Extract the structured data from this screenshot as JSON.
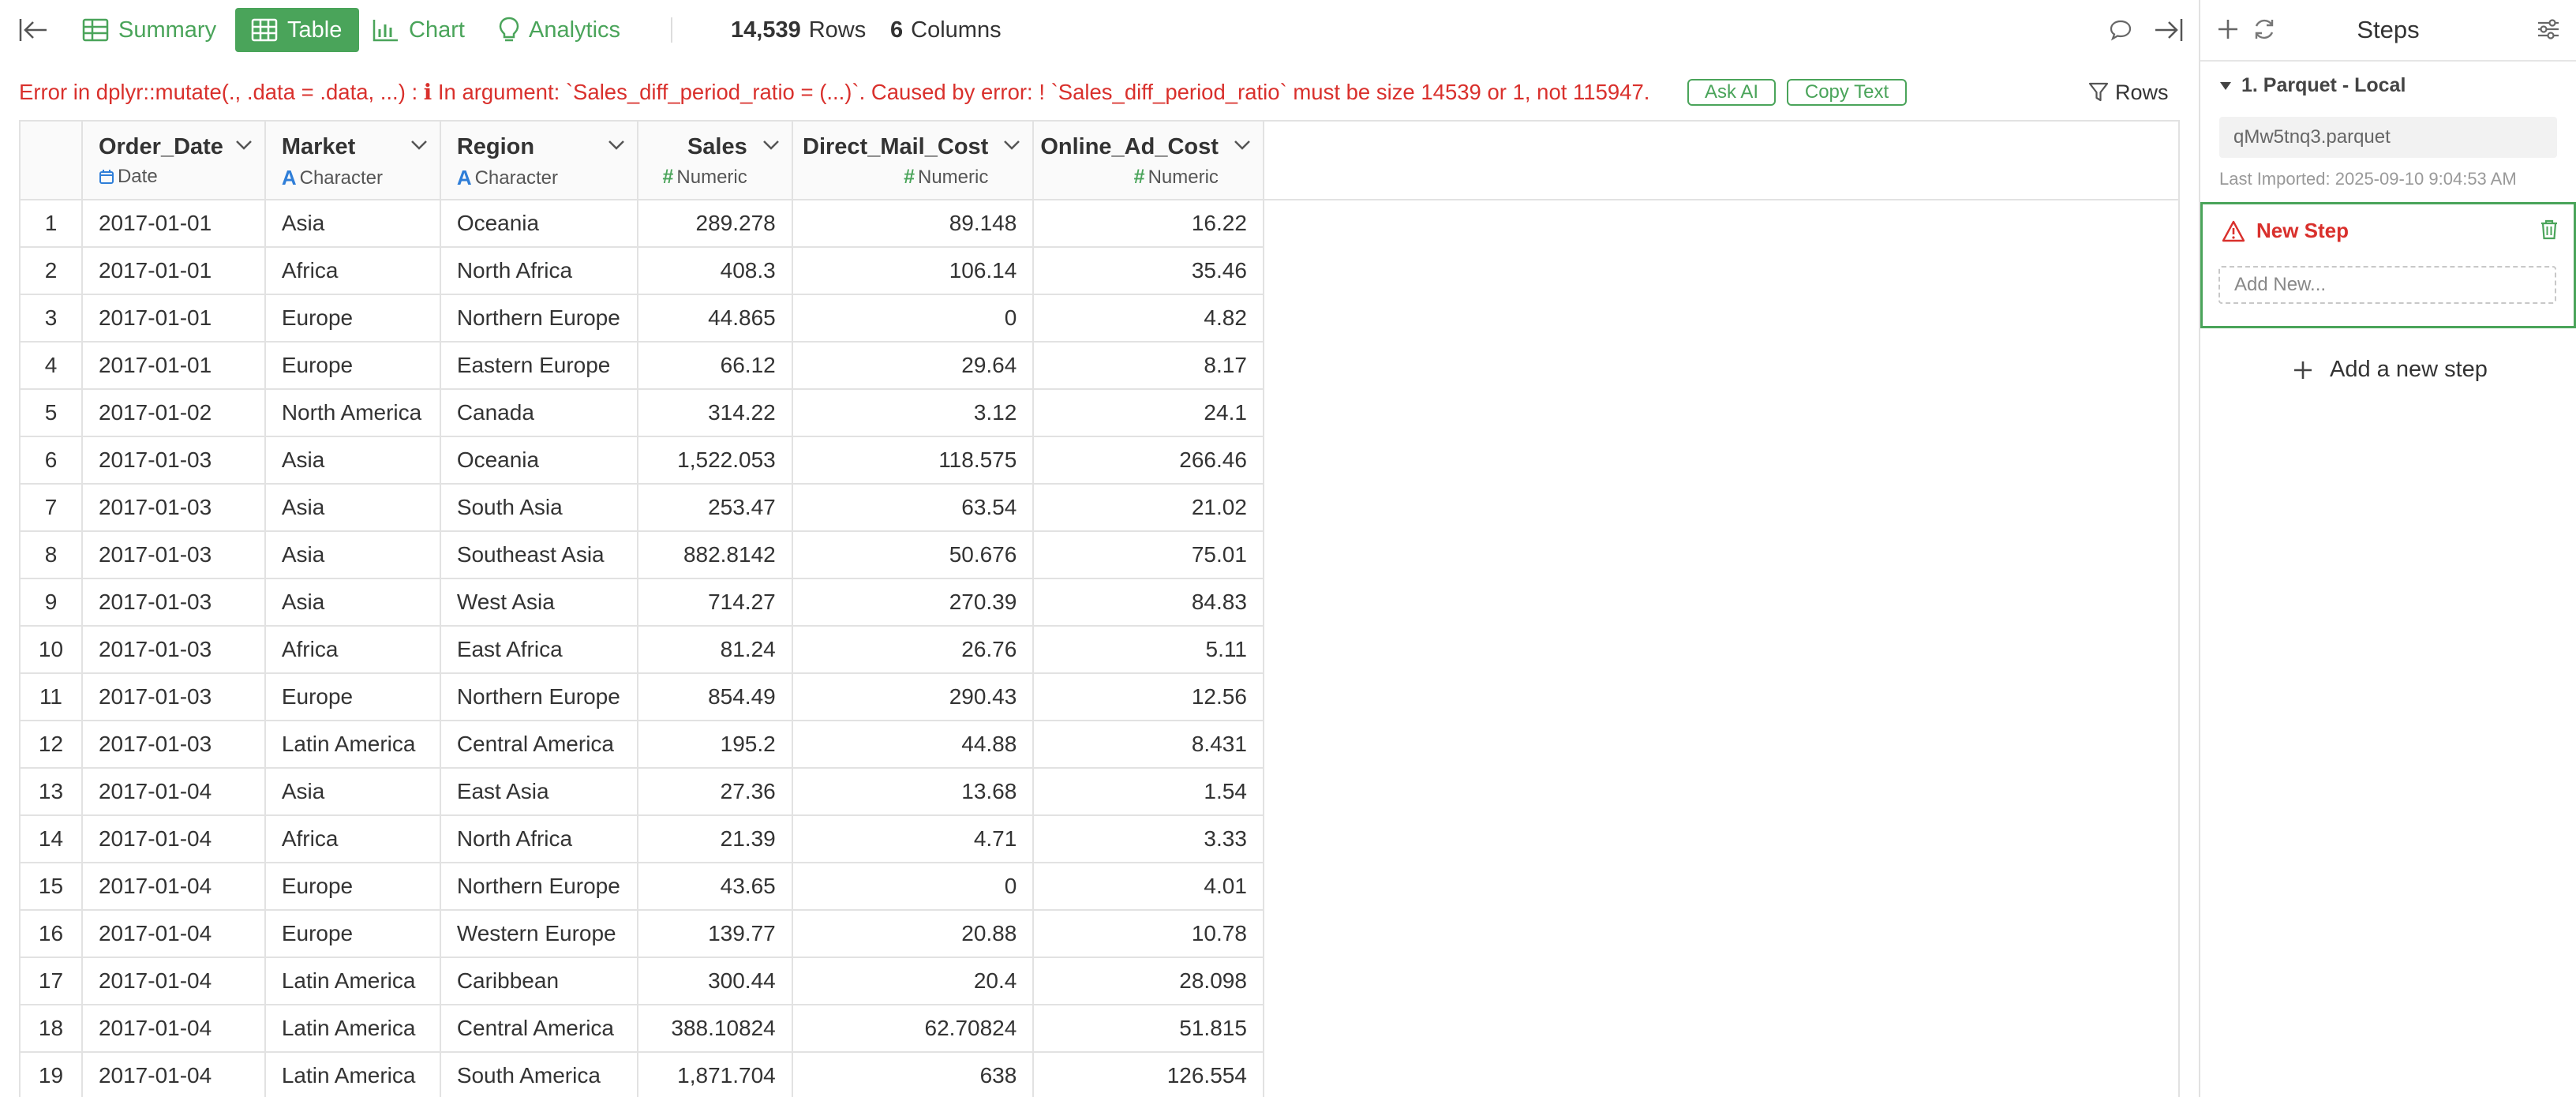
{
  "toolbar": {
    "tabs": {
      "summary": "Summary",
      "table": "Table",
      "chart": "Chart",
      "analytics": "Analytics"
    },
    "rows_count": "14,539",
    "rows_label": "Rows",
    "cols_count": "6",
    "cols_label": "Columns"
  },
  "error": {
    "message": "Error in dplyr::mutate(., .data = .data, ...) :  ℹ In argument: `Sales_diff_period_ratio = (...)`. Caused by error: ! `Sales_diff_period_ratio` must be size 14539 or 1, not 115947.",
    "ask_ai": "Ask AI",
    "copy_text": "Copy Text",
    "rows_filter": "Rows"
  },
  "table": {
    "columns": [
      {
        "name": "Order_Date",
        "type": "Date",
        "icon": "calendar-icon"
      },
      {
        "name": "Market",
        "type": "Character",
        "icon": "character-type-icon"
      },
      {
        "name": "Region",
        "type": "Character",
        "icon": "character-type-icon"
      },
      {
        "name": "Sales",
        "type": "Numeric",
        "icon": "numeric-type-icon"
      },
      {
        "name": "Direct_Mail_Cost",
        "type": "Numeric",
        "icon": "numeric-type-icon"
      },
      {
        "name": "Online_Ad_Cost",
        "type": "Numeric",
        "icon": "numeric-type-icon"
      }
    ],
    "rows": [
      [
        "1",
        "2017-01-01",
        "Asia",
        "Oceania",
        "289.278",
        "89.148",
        "16.22"
      ],
      [
        "2",
        "2017-01-01",
        "Africa",
        "North Africa",
        "408.3",
        "106.14",
        "35.46"
      ],
      [
        "3",
        "2017-01-01",
        "Europe",
        "Northern Europe",
        "44.865",
        "0",
        "4.82"
      ],
      [
        "4",
        "2017-01-01",
        "Europe",
        "Eastern Europe",
        "66.12",
        "29.64",
        "8.17"
      ],
      [
        "5",
        "2017-01-02",
        "North America",
        "Canada",
        "314.22",
        "3.12",
        "24.1"
      ],
      [
        "6",
        "2017-01-03",
        "Asia",
        "Oceania",
        "1,522.053",
        "118.575",
        "266.46"
      ],
      [
        "7",
        "2017-01-03",
        "Asia",
        "South Asia",
        "253.47",
        "63.54",
        "21.02"
      ],
      [
        "8",
        "2017-01-03",
        "Asia",
        "Southeast Asia",
        "882.8142",
        "50.676",
        "75.01"
      ],
      [
        "9",
        "2017-01-03",
        "Asia",
        "West Asia",
        "714.27",
        "270.39",
        "84.83"
      ],
      [
        "10",
        "2017-01-03",
        "Africa",
        "East Africa",
        "81.24",
        "26.76",
        "5.11"
      ],
      [
        "11",
        "2017-01-03",
        "Europe",
        "Northern Europe",
        "854.49",
        "290.43",
        "12.56"
      ],
      [
        "12",
        "2017-01-03",
        "Latin America",
        "Central America",
        "195.2",
        "44.88",
        "8.431"
      ],
      [
        "13",
        "2017-01-04",
        "Asia",
        "East Asia",
        "27.36",
        "13.68",
        "1.54"
      ],
      [
        "14",
        "2017-01-04",
        "Africa",
        "North Africa",
        "21.39",
        "4.71",
        "3.33"
      ],
      [
        "15",
        "2017-01-04",
        "Europe",
        "Northern Europe",
        "43.65",
        "0",
        "4.01"
      ],
      [
        "16",
        "2017-01-04",
        "Europe",
        "Western Europe",
        "139.77",
        "20.88",
        "10.78"
      ],
      [
        "17",
        "2017-01-04",
        "Latin America",
        "Caribbean",
        "300.44",
        "20.4",
        "28.098"
      ],
      [
        "18",
        "2017-01-04",
        "Latin America",
        "Central America",
        "388.10824",
        "62.70824",
        "51.815"
      ],
      [
        "19",
        "2017-01-04",
        "Latin America",
        "South America",
        "1,871.704",
        "638",
        "126.554"
      ]
    ]
  },
  "steps_panel": {
    "title": "Steps",
    "source": {
      "title": "1. Parquet - Local",
      "file": "qMw5tnq3.parquet",
      "last_imported": "Last Imported: 2025-09-10 9:04:53 AM"
    },
    "new_step": {
      "title": "New Step",
      "placeholder": "Add New..."
    },
    "add_step": "Add a new step"
  },
  "colors": {
    "accent": "#4aa45a",
    "error": "#d9302c",
    "character_type": "#2f7ed8"
  }
}
